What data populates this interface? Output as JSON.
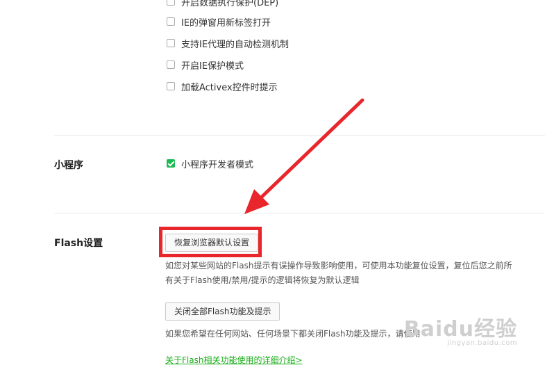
{
  "ie_options": [
    {
      "label": "开启数据执行保护(DEP)",
      "checked": false
    },
    {
      "label": "IE的弹窗用新标签打开",
      "checked": false
    },
    {
      "label": "支持IE代理的自动检测机制",
      "checked": false
    },
    {
      "label": "开启IE保护模式",
      "checked": false
    },
    {
      "label": "加载Activex控件时提示",
      "checked": false
    }
  ],
  "miniprogram": {
    "title": "小程序",
    "dev_mode_label": "小程序开发者模式",
    "dev_mode_checked": true
  },
  "flash": {
    "title": "Flash设置",
    "restore_button": "恢复浏览器默认设置",
    "restore_desc_line1": "如您对某些网站的Flash提示有误操作导致影响使用，可使用本功能复位设置，复位后您之前所",
    "restore_desc_line2": "有关于Flash使用/禁用/提示的逻辑将恢复为默认逻辑",
    "disable_button": "关闭全部Flash功能及提示",
    "disable_desc": "如果您希望在任何网站、任何场景下都关闭Flash功能及提示，请使用",
    "details_link": "关于Flash相关功能使用的详细介绍>"
  },
  "watermark": {
    "main": "Baidu经验",
    "sub": "jingyan.baidu.com"
  },
  "colors": {
    "accent_green": "#1bb953",
    "annotation_red": "#e8262b"
  }
}
